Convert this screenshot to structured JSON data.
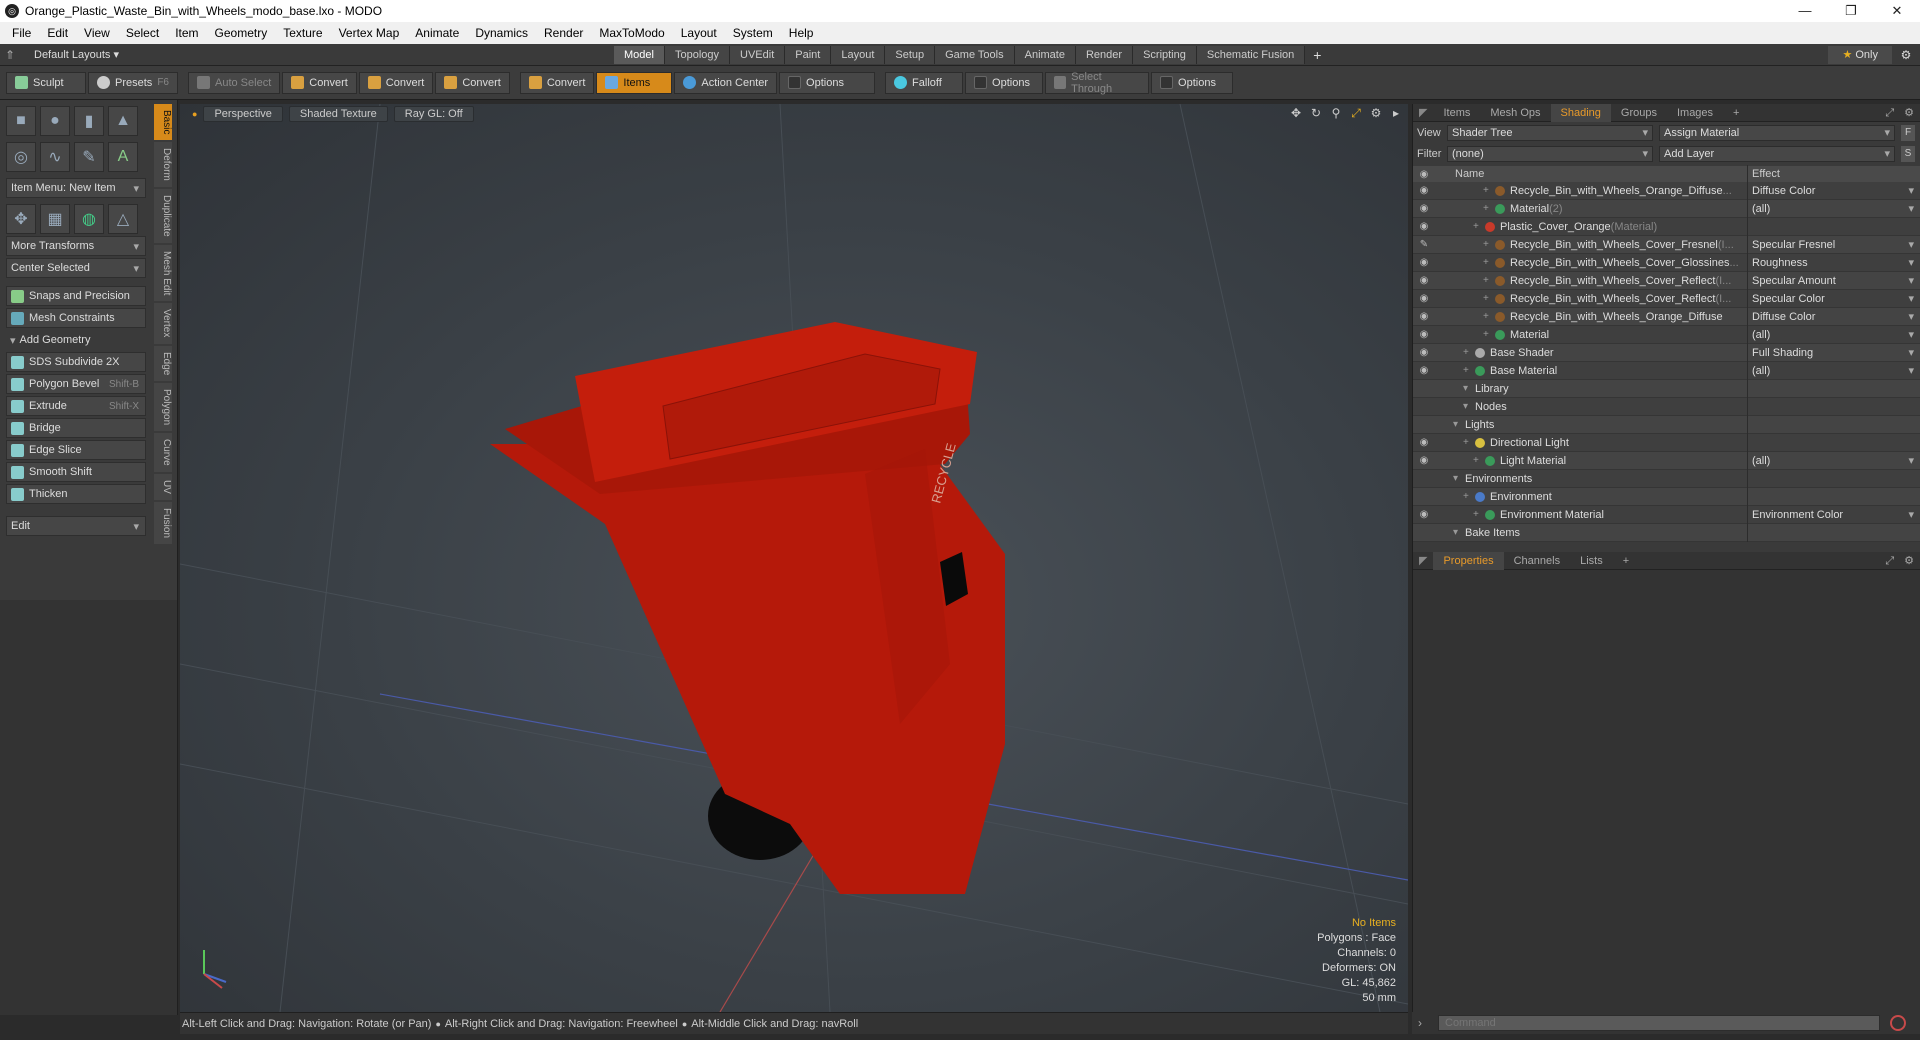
{
  "window": {
    "title": "Orange_Plastic_Waste_Bin_with_Wheels_modo_base.lxo - MODO",
    "minimize": "—",
    "maximize": "❐",
    "close": "✕"
  },
  "menu": [
    "File",
    "Edit",
    "View",
    "Select",
    "Item",
    "Geometry",
    "Texture",
    "Vertex Map",
    "Animate",
    "Dynamics",
    "Render",
    "MaxToModo",
    "Layout",
    "System",
    "Help"
  ],
  "layouts": {
    "default": "Default Layouts",
    "tabs": [
      "Model",
      "Topology",
      "UVEdit",
      "Paint",
      "Layout",
      "Setup",
      "Game Tools",
      "Animate",
      "Render",
      "Scripting",
      "Schematic Fusion"
    ],
    "active": "Model",
    "only": "Only"
  },
  "toolbar": {
    "sculpt": "Sculpt",
    "presets": "Presets",
    "presets_key": "F6",
    "auto_select": "Auto Select",
    "convert": "Convert",
    "items": "Items",
    "action_center": "Action Center",
    "options": "Options",
    "falloff": "Falloff",
    "select_through": "Select Through"
  },
  "left": {
    "item_menu": "Item Menu: New Item",
    "more_transforms": "More Transforms",
    "center_selected": "Center Selected",
    "snaps": "Snaps and Precision",
    "constraints": "Mesh Constraints",
    "add_geometry": "Add Geometry",
    "tools": [
      {
        "label": "SDS Subdivide 2X",
        "key": ""
      },
      {
        "label": "Polygon Bevel",
        "key": "Shift-B"
      },
      {
        "label": "Extrude",
        "key": "Shift-X"
      },
      {
        "label": "Bridge",
        "key": ""
      },
      {
        "label": "Edge Slice",
        "key": ""
      },
      {
        "label": "Smooth Shift",
        "key": ""
      },
      {
        "label": "Thicken",
        "key": ""
      }
    ],
    "edit": "Edit",
    "vtabs": [
      "Basic",
      "Deform",
      "Duplicate",
      "Mesh Edit",
      "Vertex",
      "Edge",
      "Polygon",
      "Curve",
      "UV",
      "Fusion"
    ]
  },
  "viewport": {
    "perspective": "Perspective",
    "shaded": "Shaded Texture",
    "raygl": "Ray GL: Off",
    "recycle_text": "RECYCLE",
    "stats": {
      "items": "No Items",
      "polygons": "Polygons : Face",
      "channels": "Channels: 0",
      "deformers": "Deformers: ON",
      "gl": "GL: 45,862",
      "mm": "50 mm"
    }
  },
  "status": {
    "t1": "Alt-Left Click and Drag: Navigation: Rotate (or Pan)",
    "t2": "Alt-Right Click and Drag: Navigation: Freewheel",
    "t3": "Alt-Middle Click and Drag: navRoll"
  },
  "shading": {
    "tabs": [
      "Items",
      "Mesh Ops",
      "Shading",
      "Groups",
      "Images"
    ],
    "active": "Shading",
    "view_label": "View",
    "view_value": "Shader Tree",
    "assign": "Assign Material",
    "filter_label": "Filter",
    "filter_value": "(none)",
    "add_layer": "Add Layer",
    "col_name": "Name",
    "col_effect": "Effect",
    "rows": [
      {
        "indent": 4,
        "name": "Recycle_Bin_with_Wheels_Orange_Diffuse",
        "suffix": " ...",
        "effect": "Diffuse Color",
        "dot": "#8a5a2a",
        "eye": "◉",
        "dd": true
      },
      {
        "indent": 4,
        "name": "Material",
        "suffix": " (2)",
        "effect": "(all)",
        "dot": "#3a9a5a",
        "eye": "◉",
        "dd": true
      },
      {
        "indent": 3,
        "name": "Plastic_Cover_Orange",
        "suffix": " (Material)",
        "effect": "",
        "dot": "#c83a2a",
        "eye": "◉",
        "dd": false
      },
      {
        "indent": 4,
        "name": "Recycle_Bin_with_Wheels_Cover_Fresnel",
        "suffix": " (I...",
        "effect": "Specular Fresnel",
        "dot": "#8a5a2a",
        "eye": "✎",
        "dd": true
      },
      {
        "indent": 4,
        "name": "Recycle_Bin_with_Wheels_Cover_Glossines",
        "suffix": " ...",
        "effect": "Roughness",
        "dot": "#8a5a2a",
        "eye": "◉",
        "dd": true
      },
      {
        "indent": 4,
        "name": "Recycle_Bin_with_Wheels_Cover_Reflect",
        "suffix": " (I...",
        "effect": "Specular Amount",
        "dot": "#8a5a2a",
        "eye": "◉",
        "dd": true
      },
      {
        "indent": 4,
        "name": "Recycle_Bin_with_Wheels_Cover_Reflect",
        "suffix": " (I...",
        "effect": "Specular Color",
        "dot": "#8a5a2a",
        "eye": "◉",
        "dd": true
      },
      {
        "indent": 4,
        "name": "Recycle_Bin_with_Wheels_Orange_Diffuse",
        "suffix": "",
        "effect": "Diffuse Color",
        "dot": "#8a5a2a",
        "eye": "◉",
        "dd": true
      },
      {
        "indent": 4,
        "name": "Material",
        "suffix": "",
        "effect": "(all)",
        "dot": "#3a9a5a",
        "eye": "◉",
        "dd": true
      },
      {
        "indent": 2,
        "name": "Base Shader",
        "suffix": "",
        "effect": "Full Shading",
        "dot": "#aaaaaa",
        "eye": "◉",
        "dd": true
      },
      {
        "indent": 2,
        "name": "Base Material",
        "suffix": "",
        "effect": "(all)",
        "dot": "#3a9a5a",
        "eye": "◉",
        "dd": true
      },
      {
        "indent": 2,
        "name": "Library",
        "suffix": "",
        "effect": "",
        "dot": "",
        "eye": "",
        "dd": false
      },
      {
        "indent": 2,
        "name": "Nodes",
        "suffix": "",
        "effect": "",
        "dot": "",
        "eye": "",
        "dd": false
      },
      {
        "indent": 1,
        "name": "Lights",
        "suffix": "",
        "effect": "",
        "dot": "",
        "eye": "",
        "dd": false
      },
      {
        "indent": 2,
        "name": "Directional Light",
        "suffix": "",
        "effect": "",
        "dot": "#d8c040",
        "eye": "◉",
        "dd": false
      },
      {
        "indent": 3,
        "name": "Light Material",
        "suffix": "",
        "effect": "(all)",
        "dot": "#3a9a5a",
        "eye": "◉",
        "dd": true
      },
      {
        "indent": 1,
        "name": "Environments",
        "suffix": "",
        "effect": "",
        "dot": "",
        "eye": "",
        "dd": false
      },
      {
        "indent": 2,
        "name": "Environment",
        "suffix": "",
        "effect": "",
        "dot": "#4a7ac8",
        "eye": "",
        "dd": false
      },
      {
        "indent": 3,
        "name": "Environment Material",
        "suffix": "",
        "effect": "Environment Color",
        "dot": "#3a9a5a",
        "eye": "◉",
        "dd": true
      },
      {
        "indent": 1,
        "name": "Bake Items",
        "suffix": "",
        "effect": "",
        "dot": "",
        "eye": "",
        "dd": false
      }
    ]
  },
  "props": {
    "tabs": [
      "Properties",
      "Channels",
      "Lists"
    ],
    "active": "Properties"
  },
  "command": {
    "placeholder": "Command"
  },
  "colors": {
    "accent": "#d78a1a",
    "bin": "#b81a0a"
  }
}
